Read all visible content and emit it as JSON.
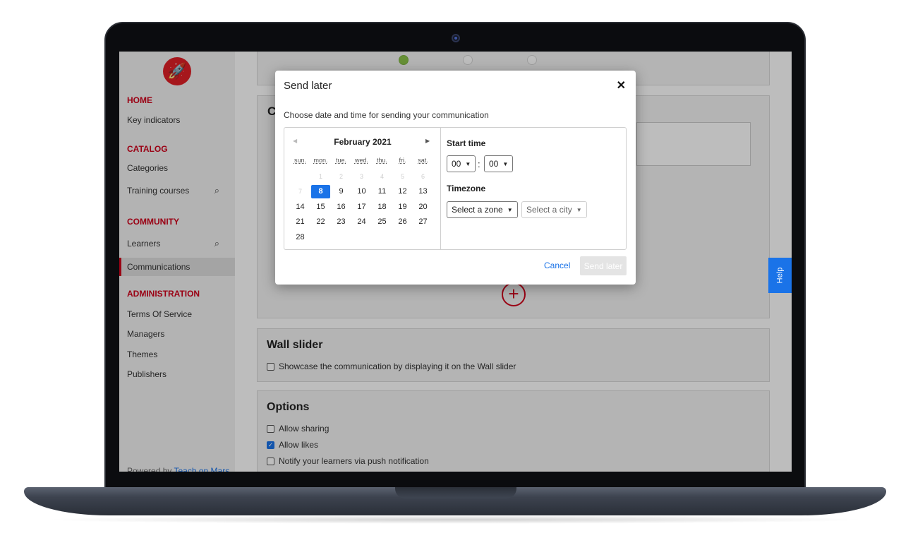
{
  "sidebar": {
    "sections": [
      {
        "title": "HOME",
        "items": [
          {
            "label": "Key indicators"
          }
        ]
      },
      {
        "title": "CATALOG",
        "items": [
          {
            "label": "Categories"
          },
          {
            "label": "Training courses"
          }
        ]
      },
      {
        "title": "COMMUNITY",
        "items": [
          {
            "label": "Learners"
          },
          {
            "label": "Communications"
          }
        ]
      },
      {
        "title": "ADMINISTRATION",
        "items": [
          {
            "label": "Terms Of Service"
          },
          {
            "label": "Managers"
          },
          {
            "label": "Themes"
          },
          {
            "label": "Publishers"
          }
        ]
      }
    ],
    "active_item": "Communications",
    "powered_prefix": "Powered by",
    "powered_link": "Teach on Mars"
  },
  "main": {
    "content_title_partial": "Co",
    "wall_slider": {
      "title": "Wall slider",
      "checkbox_label": "Showcase the communication by displaying it on the Wall slider",
      "checked": false
    },
    "options": {
      "title": "Options",
      "items": [
        {
          "label": "Allow sharing",
          "checked": false
        },
        {
          "label": "Allow likes",
          "checked": true
        },
        {
          "label": "Notify your learners via push notification",
          "checked": false
        }
      ]
    },
    "help_label": "Help"
  },
  "modal": {
    "title": "Send later",
    "close_glyph": "✕",
    "subtitle": "Choose date and time for sending your communication",
    "calendar": {
      "month_label": "February  2021",
      "weekdays": [
        "sun.",
        "mon.",
        "tue.",
        "wed.",
        "thu.",
        "fri.",
        "sat."
      ],
      "muted_days": [
        "1",
        "2",
        "3",
        "4",
        "5",
        "6",
        "7"
      ],
      "selected_day": "8",
      "days": [
        "9",
        "10",
        "11",
        "12",
        "13",
        "14",
        "15",
        "16",
        "17",
        "18",
        "19",
        "20",
        "21",
        "22",
        "23",
        "24",
        "25",
        "26",
        "27",
        "28"
      ]
    },
    "start_time_label": "Start time",
    "hour_value": "00",
    "minute_value": "00",
    "time_separator": ":",
    "timezone_label": "Timezone",
    "zone_select": "Select a zone",
    "city_select": "Select a city",
    "cancel_label": "Cancel",
    "send_label": "Send later"
  },
  "colors": {
    "accent_red": "#d0021b",
    "accent_blue": "#1a73e8",
    "step_done": "#8bc34a"
  }
}
